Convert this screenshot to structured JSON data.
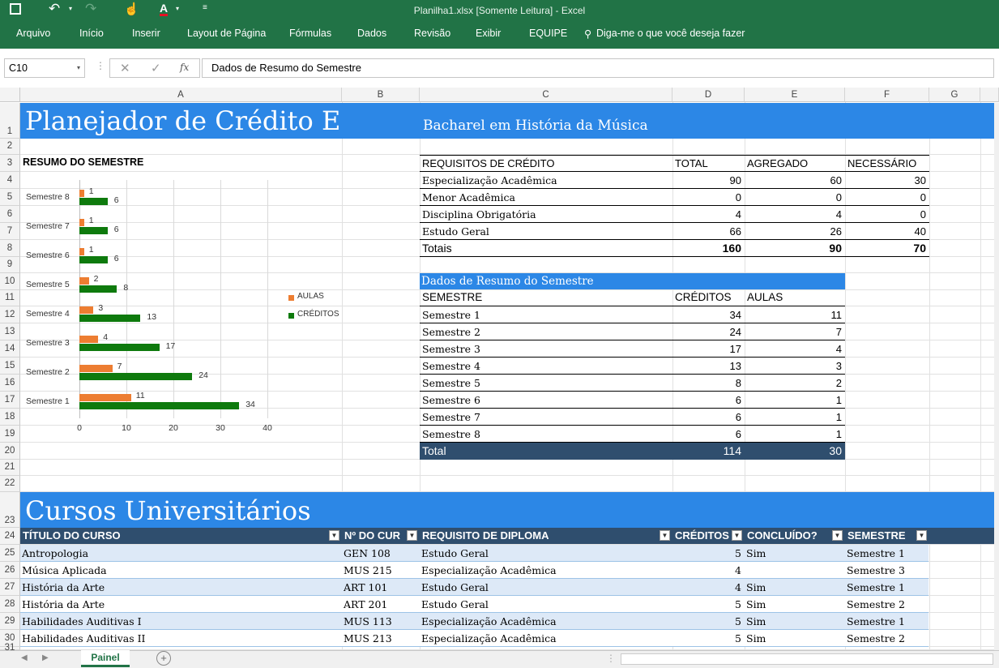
{
  "window_title": "Planilha1.xlsx [Somente Leitura] - Excel",
  "menu": [
    "Arquivo",
    "Início",
    "Inserir",
    "Layout de Página",
    "Fórmulas",
    "Dados",
    "Revisão",
    "Exibir",
    "EQUIPE"
  ],
  "tellme": "Diga-me o que você deseja fazer",
  "namebox": "C10",
  "formula": "Dados de Resumo do Semestre",
  "fx": "fx",
  "columns": [
    "A",
    "B",
    "C",
    "D",
    "E",
    "F",
    "G"
  ],
  "rows": [
    "1",
    "2",
    "3",
    "4",
    "5",
    "6",
    "7",
    "8",
    "9",
    "10",
    "11",
    "12",
    "13",
    "14",
    "15",
    "16",
    "17",
    "18",
    "19",
    "20",
    "21",
    "22",
    "23",
    "24",
    "25",
    "26",
    "27",
    "28",
    "29",
    "30",
    "31"
  ],
  "title": "Planejador de Crédito E",
  "subtitle": "Bacharel em História da Música",
  "resumo_label": "RESUMO DO SEMESTRE",
  "credit_table": {
    "headers": [
      "REQUISITOS DE CRÉDITO",
      "TOTAL",
      "AGREGADO",
      "NECESSÁRIO"
    ],
    "rows": [
      [
        "Especialização Acadêmica",
        "90",
        "60",
        "30"
      ],
      [
        "Menor Acadêmica",
        "0",
        "0",
        "0"
      ],
      [
        "Disciplina Obrigatória",
        "4",
        "4",
        "0"
      ],
      [
        "Estudo Geral",
        "66",
        "26",
        "40"
      ]
    ],
    "totals": [
      "Totais",
      "160",
      "90",
      "70"
    ]
  },
  "semester_table": {
    "title": "Dados de Resumo do Semestre",
    "headers": [
      "SEMESTRE",
      "CRÉDITOS",
      "AULAS"
    ],
    "rows": [
      [
        "Semestre 1",
        "34",
        "11"
      ],
      [
        "Semestre 2",
        "24",
        "7"
      ],
      [
        "Semestre 3",
        "17",
        "4"
      ],
      [
        "Semestre 4",
        "13",
        "3"
      ],
      [
        "Semestre 5",
        "8",
        "2"
      ],
      [
        "Semestre 6",
        "6",
        "1"
      ],
      [
        "Semestre 7",
        "6",
        "1"
      ],
      [
        "Semestre 8",
        "6",
        "1"
      ]
    ],
    "total": [
      "Total",
      "114",
      "30"
    ]
  },
  "chart_data": {
    "type": "bar",
    "orientation": "horizontal",
    "categories": [
      "Semestre 8",
      "Semestre 7",
      "Semestre 6",
      "Semestre 5",
      "Semestre 4",
      "Semestre 3",
      "Semestre 2",
      "Semestre 1"
    ],
    "series": [
      {
        "name": "AULAS",
        "color": "#ed7d31",
        "values": [
          1,
          1,
          1,
          2,
          3,
          4,
          7,
          11
        ]
      },
      {
        "name": "CRÉDITOS",
        "color": "#0e7a0d",
        "values": [
          6,
          6,
          6,
          8,
          13,
          17,
          24,
          34
        ]
      }
    ],
    "xticks": [
      "0",
      "10",
      "20",
      "30",
      "40"
    ],
    "xlim": [
      0,
      40
    ],
    "legend": "right"
  },
  "courses": {
    "title": "Cursos Universitários",
    "headers": [
      "TÍTULO DO CURSO",
      "Nº DO CUR",
      "REQUISITO DE DIPLOMA",
      "CRÉDITOS",
      "CONCLUÍDO?",
      "SEMESTRE"
    ],
    "rows": [
      [
        "Antropologia",
        "GEN 108",
        "Estudo Geral",
        "5",
        "Sim",
        "Semestre 1"
      ],
      [
        "Música Aplicada",
        "MUS 215",
        "Especialização Acadêmica",
        "4",
        "",
        "Semestre 3"
      ],
      [
        "História da Arte",
        "ART 101",
        "Estudo Geral",
        "4",
        "Sim",
        "Semestre 1"
      ],
      [
        "História da Arte",
        "ART 201",
        "Estudo Geral",
        "5",
        "Sim",
        "Semestre 2"
      ],
      [
        "Habilidades Auditivas I",
        "MUS 113",
        "Especialização Acadêmica",
        "5",
        "Sim",
        "Semestre 1"
      ],
      [
        "Habilidades Auditivas II",
        "MUS 213",
        "Especialização Acadêmica",
        "5",
        "Sim",
        "Semestre 2"
      ]
    ]
  },
  "sheet_tab": "Painel",
  "colors": {
    "ribbon": "#217346",
    "band": "#2c87e6",
    "table_header": "#2f4e6e",
    "stripe": "#dde9f7"
  }
}
